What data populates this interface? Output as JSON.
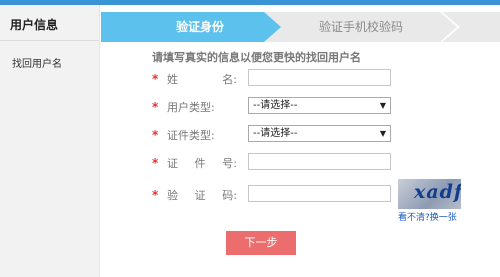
{
  "sidebar": {
    "title": "用户信息",
    "items": [
      {
        "label": "找回用户名"
      }
    ]
  },
  "steps": [
    {
      "label": "验证身份",
      "active": true
    },
    {
      "label": "验证手机校验码",
      "active": false
    }
  ],
  "form": {
    "intro": "请填写真实的信息以便您更快的找回用户名",
    "required_mark": "*",
    "name": {
      "label_chars": [
        "姓",
        "名:"
      ],
      "value": ""
    },
    "user_type": {
      "label": "用户类型:",
      "selected": "--请选择--"
    },
    "id_type": {
      "label": "证件类型:",
      "selected": "--请选择--"
    },
    "id_number": {
      "label_chars": [
        "证",
        "件",
        "号:"
      ],
      "value": ""
    },
    "captcha": {
      "label_chars": [
        "验",
        "证",
        "码:"
      ],
      "value": "",
      "image_text": "xadf",
      "refresh_label": "看不清?换一张"
    },
    "next_label": "下一步"
  },
  "colors": {
    "topbar": "#3a95d6",
    "active_step": "#5cc1ec",
    "required": "#e8312f",
    "next_button": "#ec6d6d",
    "link": "#1a58c8"
  }
}
